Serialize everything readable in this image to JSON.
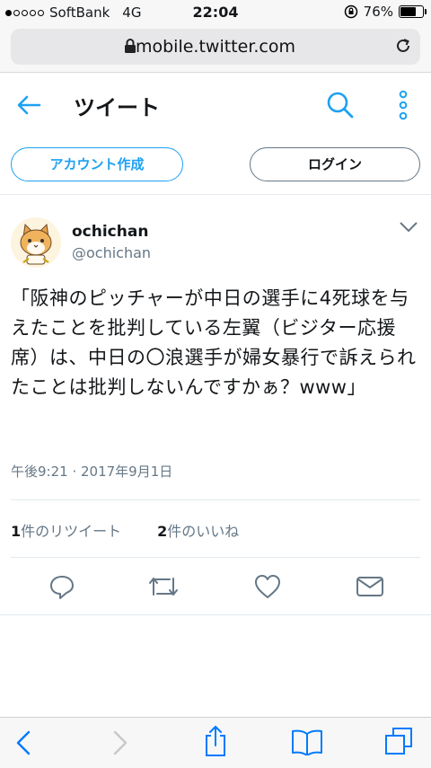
{
  "status_bar": {
    "carrier": "SoftBank",
    "network": "4G",
    "time": "22:04",
    "battery_percent_label": "76%",
    "battery_level": 0.76
  },
  "browser": {
    "url": "mobile.twitter.com"
  },
  "header": {
    "title": "ツイート"
  },
  "auth": {
    "signup_label": "アカウント作成",
    "login_label": "ログイン"
  },
  "tweet": {
    "display_name": "ochichan",
    "handle": "@ochichan",
    "text": "「阪神のピッチャーが中日の選手に4死球を与えたことを批判している左翼（ビジター応援席）は、中日の〇浪選手が婦女暴行で訴えられたことは批判しないんですかぁ？www」",
    "timestamp": "午後9:21 · 2017年9月1日",
    "retweet_count": "1",
    "retweet_label": "件のリツイート",
    "like_count": "2",
    "like_label": "件のいいね"
  },
  "colors": {
    "accent": "#1da1f2",
    "secondary": "#657786",
    "safari_blue": "#007aff"
  },
  "icons": [
    "back-arrow-icon",
    "search-icon",
    "more-vertical-icon",
    "chevron-down-icon",
    "reply-icon",
    "retweet-icon",
    "like-icon",
    "dm-icon",
    "lock-icon",
    "reload-icon",
    "safari-back-icon",
    "safari-forward-icon",
    "share-icon",
    "bookmarks-icon",
    "tabs-icon"
  ]
}
